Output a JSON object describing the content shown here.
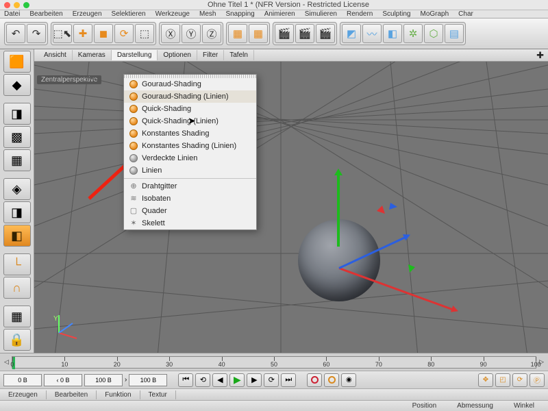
{
  "window": {
    "title": "Ohne Titel 1 * (NFR Version - Restricted License"
  },
  "menubar": [
    "Datei",
    "Bearbeiten",
    "Erzeugen",
    "Selektieren",
    "Werkzeuge",
    "Mesh",
    "Snapping",
    "Animieren",
    "Simulieren",
    "Rendern",
    "Sculpting",
    "MoGraph",
    "Char"
  ],
  "viewport": {
    "tabs": [
      "Ansicht",
      "Kameras",
      "Darstellung",
      "Optionen",
      "Filter",
      "Tafeln"
    ],
    "active_tab": "Darstellung",
    "badge": "Zentralperspektive",
    "miniaxis_label": "Y"
  },
  "dropdown": {
    "items": [
      {
        "label": "Gouraud-Shading",
        "icon": "orange"
      },
      {
        "label": "Gouraud-Shading (Linien)",
        "icon": "orange",
        "highlight": true
      },
      {
        "label": "Quick-Shading",
        "icon": "orange"
      },
      {
        "label": "Quick-Shading (Linien)",
        "icon": "orange"
      },
      {
        "label": "Konstantes Shading",
        "icon": "orange"
      },
      {
        "label": "Konstantes Shading (Linien)",
        "icon": "orange"
      },
      {
        "label": "Verdeckte Linien",
        "icon": "grey"
      },
      {
        "label": "Linien",
        "icon": "grey"
      }
    ],
    "items2": [
      {
        "label": "Drahtgitter",
        "glyph": "⊕"
      },
      {
        "label": "Isobaten",
        "glyph": "≋"
      },
      {
        "label": "Quader",
        "glyph": "▢"
      },
      {
        "label": "Skelett",
        "glyph": "✶"
      }
    ]
  },
  "timeline": {
    "ticks": [
      0,
      10,
      20,
      30,
      40,
      50,
      60,
      70,
      80,
      90,
      100
    ],
    "fields": {
      "cur": "0 B",
      "startMark": "‹ 0 B",
      "startVal": "100 B",
      "endVal": "100 B"
    }
  },
  "bottomtabs": [
    "Erzeugen",
    "Bearbeiten",
    "Funktion",
    "Textur"
  ],
  "status": [
    "Position",
    "Abmessung",
    "Winkel"
  ]
}
